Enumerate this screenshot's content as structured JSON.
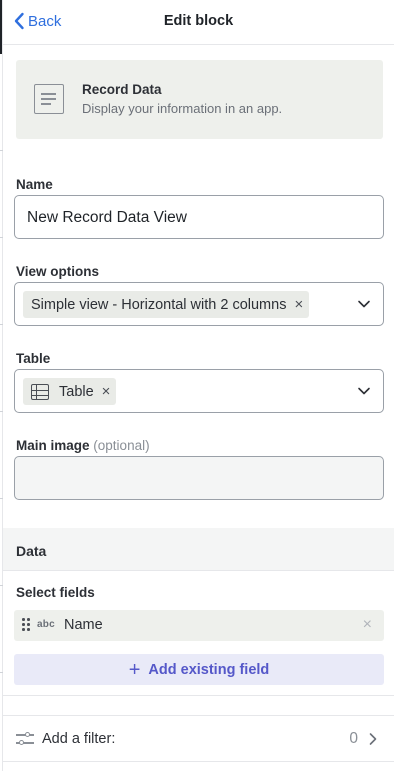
{
  "header": {
    "back_label": "Back",
    "title": "Edit block"
  },
  "block_card": {
    "icon": "document-icon",
    "title": "Record Data",
    "description": "Display your information in an app."
  },
  "name": {
    "label": "Name",
    "value": "New Record Data View"
  },
  "view_options": {
    "label": "View options",
    "selected": "Simple view - Horizontal with 2 columns",
    "remove_glyph": "×"
  },
  "table": {
    "label": "Table",
    "selected": "Table",
    "icon": "table-icon",
    "remove_glyph": "×"
  },
  "main_image": {
    "label": "Main image",
    "optional_note": "(optional)",
    "value": ""
  },
  "data_section": {
    "title": "Data",
    "select_fields_label": "Select fields",
    "fields": [
      {
        "type_badge": "abc",
        "name": "Name",
        "remove_glyph": "×"
      }
    ],
    "add_button_glyph": "+",
    "add_button_label": "Add existing field"
  },
  "filter": {
    "label": "Add a filter:",
    "count": "0",
    "icon": "sliders-icon"
  },
  "colors": {
    "accent": "#2f6fde",
    "add_field_text": "#5558c9",
    "add_field_bg": "#e9eaf8",
    "card_bg": "#eef0ec"
  }
}
